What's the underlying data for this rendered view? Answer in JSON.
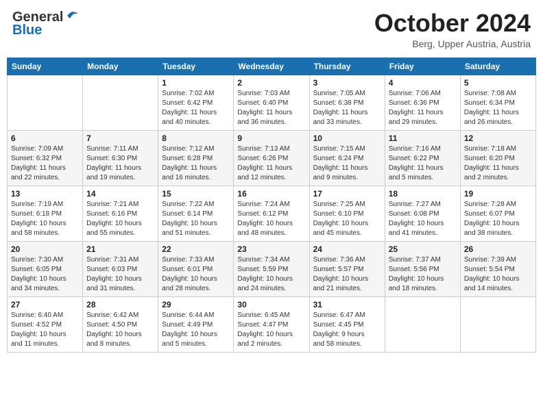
{
  "header": {
    "logo_line1": "General",
    "logo_line2": "Blue",
    "month": "October 2024",
    "location": "Berg, Upper Austria, Austria"
  },
  "weekdays": [
    "Sunday",
    "Monday",
    "Tuesday",
    "Wednesday",
    "Thursday",
    "Friday",
    "Saturday"
  ],
  "weeks": [
    [
      {
        "day": "",
        "info": ""
      },
      {
        "day": "",
        "info": ""
      },
      {
        "day": "1",
        "info": "Sunrise: 7:02 AM\nSunset: 6:42 PM\nDaylight: 11 hours\nand 40 minutes."
      },
      {
        "day": "2",
        "info": "Sunrise: 7:03 AM\nSunset: 6:40 PM\nDaylight: 11 hours\nand 36 minutes."
      },
      {
        "day": "3",
        "info": "Sunrise: 7:05 AM\nSunset: 6:38 PM\nDaylight: 11 hours\nand 33 minutes."
      },
      {
        "day": "4",
        "info": "Sunrise: 7:06 AM\nSunset: 6:36 PM\nDaylight: 11 hours\nand 29 minutes."
      },
      {
        "day": "5",
        "info": "Sunrise: 7:08 AM\nSunset: 6:34 PM\nDaylight: 11 hours\nand 26 minutes."
      }
    ],
    [
      {
        "day": "6",
        "info": "Sunrise: 7:09 AM\nSunset: 6:32 PM\nDaylight: 11 hours\nand 22 minutes."
      },
      {
        "day": "7",
        "info": "Sunrise: 7:11 AM\nSunset: 6:30 PM\nDaylight: 11 hours\nand 19 minutes."
      },
      {
        "day": "8",
        "info": "Sunrise: 7:12 AM\nSunset: 6:28 PM\nDaylight: 11 hours\nand 16 minutes."
      },
      {
        "day": "9",
        "info": "Sunrise: 7:13 AM\nSunset: 6:26 PM\nDaylight: 11 hours\nand 12 minutes."
      },
      {
        "day": "10",
        "info": "Sunrise: 7:15 AM\nSunset: 6:24 PM\nDaylight: 11 hours\nand 9 minutes."
      },
      {
        "day": "11",
        "info": "Sunrise: 7:16 AM\nSunset: 6:22 PM\nDaylight: 11 hours\nand 5 minutes."
      },
      {
        "day": "12",
        "info": "Sunrise: 7:18 AM\nSunset: 6:20 PM\nDaylight: 11 hours\nand 2 minutes."
      }
    ],
    [
      {
        "day": "13",
        "info": "Sunrise: 7:19 AM\nSunset: 6:18 PM\nDaylight: 10 hours\nand 58 minutes."
      },
      {
        "day": "14",
        "info": "Sunrise: 7:21 AM\nSunset: 6:16 PM\nDaylight: 10 hours\nand 55 minutes."
      },
      {
        "day": "15",
        "info": "Sunrise: 7:22 AM\nSunset: 6:14 PM\nDaylight: 10 hours\nand 51 minutes."
      },
      {
        "day": "16",
        "info": "Sunrise: 7:24 AM\nSunset: 6:12 PM\nDaylight: 10 hours\nand 48 minutes."
      },
      {
        "day": "17",
        "info": "Sunrise: 7:25 AM\nSunset: 6:10 PM\nDaylight: 10 hours\nand 45 minutes."
      },
      {
        "day": "18",
        "info": "Sunrise: 7:27 AM\nSunset: 6:08 PM\nDaylight: 10 hours\nand 41 minutes."
      },
      {
        "day": "19",
        "info": "Sunrise: 7:28 AM\nSunset: 6:07 PM\nDaylight: 10 hours\nand 38 minutes."
      }
    ],
    [
      {
        "day": "20",
        "info": "Sunrise: 7:30 AM\nSunset: 6:05 PM\nDaylight: 10 hours\nand 34 minutes."
      },
      {
        "day": "21",
        "info": "Sunrise: 7:31 AM\nSunset: 6:03 PM\nDaylight: 10 hours\nand 31 minutes."
      },
      {
        "day": "22",
        "info": "Sunrise: 7:33 AM\nSunset: 6:01 PM\nDaylight: 10 hours\nand 28 minutes."
      },
      {
        "day": "23",
        "info": "Sunrise: 7:34 AM\nSunset: 5:59 PM\nDaylight: 10 hours\nand 24 minutes."
      },
      {
        "day": "24",
        "info": "Sunrise: 7:36 AM\nSunset: 5:57 PM\nDaylight: 10 hours\nand 21 minutes."
      },
      {
        "day": "25",
        "info": "Sunrise: 7:37 AM\nSunset: 5:56 PM\nDaylight: 10 hours\nand 18 minutes."
      },
      {
        "day": "26",
        "info": "Sunrise: 7:39 AM\nSunset: 5:54 PM\nDaylight: 10 hours\nand 14 minutes."
      }
    ],
    [
      {
        "day": "27",
        "info": "Sunrise: 6:40 AM\nSunset: 4:52 PM\nDaylight: 10 hours\nand 11 minutes."
      },
      {
        "day": "28",
        "info": "Sunrise: 6:42 AM\nSunset: 4:50 PM\nDaylight: 10 hours\nand 8 minutes."
      },
      {
        "day": "29",
        "info": "Sunrise: 6:44 AM\nSunset: 4:49 PM\nDaylight: 10 hours\nand 5 minutes."
      },
      {
        "day": "30",
        "info": "Sunrise: 6:45 AM\nSunset: 4:47 PM\nDaylight: 10 hours\nand 2 minutes."
      },
      {
        "day": "31",
        "info": "Sunrise: 6:47 AM\nSunset: 4:45 PM\nDaylight: 9 hours\nand 58 minutes."
      },
      {
        "day": "",
        "info": ""
      },
      {
        "day": "",
        "info": ""
      }
    ]
  ]
}
